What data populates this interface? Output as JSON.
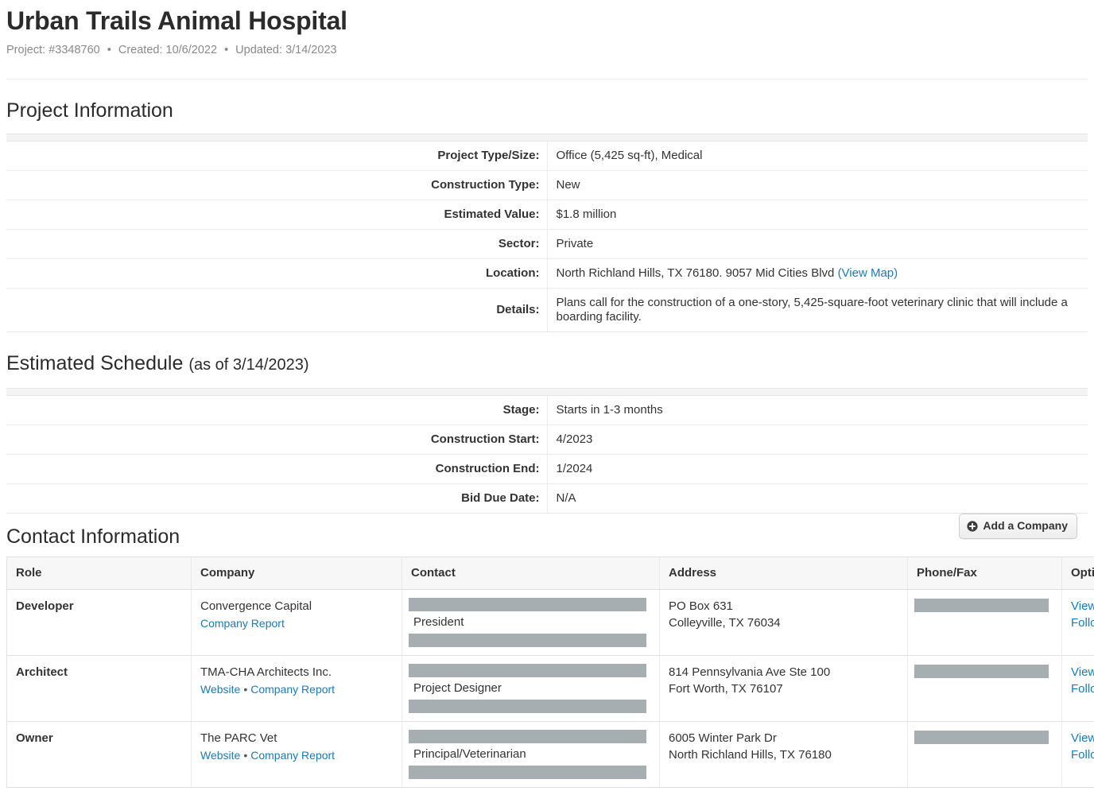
{
  "header": {
    "title": "Urban Trails Animal Hospital",
    "meta": {
      "project_label": "Project:",
      "project_value": "#3348760",
      "created_label": "Created:",
      "created_value": "10/6/2022",
      "updated_label": "Updated:",
      "updated_value": "3/14/2023",
      "separator": "•"
    }
  },
  "project_information": {
    "heading": "Project Information",
    "rows": [
      {
        "label": "Project Type/Size:",
        "value": "Office (5,425 sq-ft), Medical"
      },
      {
        "label": "Construction Type:",
        "value": "New"
      },
      {
        "label": "Estimated Value:",
        "value": "$1.8 million"
      },
      {
        "label": "Sector:",
        "value": "Private"
      },
      {
        "label": "Location:",
        "value": "North Richland Hills, TX 76180. 9057 Mid Cities Blvd",
        "link": "(View Map)"
      },
      {
        "label": "Details:",
        "value": "Plans call for the construction of a one-story, 5,425-square-foot veterinary clinic that will include a boarding facility."
      }
    ]
  },
  "estimated_schedule": {
    "heading": "Estimated Schedule",
    "subheading": "(as of 3/14/2023)",
    "rows": [
      {
        "label": "Stage:",
        "value": "Starts in 1-3 months"
      },
      {
        "label": "Construction Start:",
        "value": "4/2023"
      },
      {
        "label": "Construction End:",
        "value": "1/2024"
      },
      {
        "label": "Bid Due Date:",
        "value": "N/A"
      }
    ]
  },
  "contact_information": {
    "heading": "Contact Information",
    "add_button": "Add a Company",
    "columns": [
      "Role",
      "Company",
      "Contact",
      "Address",
      "Phone/Fax",
      "Options"
    ],
    "rows": [
      {
        "role": "Developer",
        "company": "Convergence Capital",
        "company_links": [
          "Company Report"
        ],
        "contact_title": "President",
        "address_line1": "PO Box 631",
        "address_line2": "Colleyville, TX 76034",
        "options": [
          "View Projects",
          "Follow"
        ]
      },
      {
        "role": "Architect",
        "company": "TMA-CHA Architects Inc.",
        "company_links": [
          "Website",
          "Company Report"
        ],
        "contact_title": "Project Designer",
        "address_line1": "814 Pennsylvania Ave Ste 100",
        "address_line2": "Fort Worth, TX 76107",
        "options": [
          "View Projects",
          "Follow"
        ]
      },
      {
        "role": "Owner",
        "company": "The PARC Vet",
        "company_links": [
          "Website",
          "Company Report"
        ],
        "contact_title": "Principal/Veterinarian",
        "address_line1": "6005 Winter Park Dr",
        "address_line2": "North Richland Hills, TX 76180",
        "options": [
          "View Projects",
          "Follow"
        ]
      }
    ]
  },
  "colors": {
    "link": "#1a7bb9",
    "text": "#333333",
    "muted": "#8a8a8a",
    "redaction": "#a7aeb2",
    "table_header_bg": "#f7f7f7",
    "border": "#e2e2e2"
  },
  "icons": {
    "add": "plus-circle-icon"
  }
}
